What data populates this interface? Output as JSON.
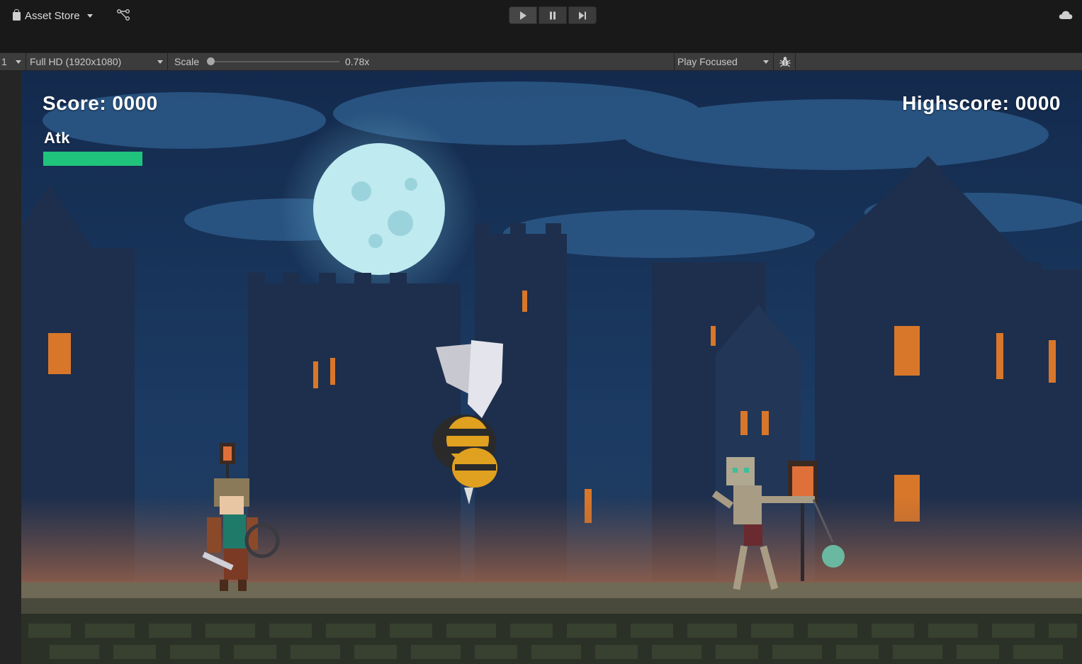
{
  "toolbar": {
    "asset_store_label": "Asset Store",
    "icons": {
      "asset_store": "shopping-bag-icon",
      "graph": "package-graph-icon",
      "cloud": "cloud-icon"
    },
    "playback": {
      "play": "play-icon",
      "pause": "pause-icon",
      "step": "step-forward-icon"
    }
  },
  "game_bar": {
    "display_value": "1",
    "resolution_value": "Full HD (1920x1080)",
    "scale_label": "Scale",
    "scale_value_text": "0.78x",
    "scale_value": 0.78,
    "play_mode_value": "Play Focused",
    "bug_icon": "bug-icon"
  },
  "hud": {
    "score": "Score: 0000",
    "highscore": "Highscore: 0000",
    "atk_label": "Atk",
    "atk_fill": 1.0,
    "atk_color": "#20c37b"
  },
  "scene": {
    "sprites": [
      "moon",
      "castle",
      "hero",
      "giant-bee",
      "skeleton-with-flail",
      "stone-path"
    ]
  }
}
